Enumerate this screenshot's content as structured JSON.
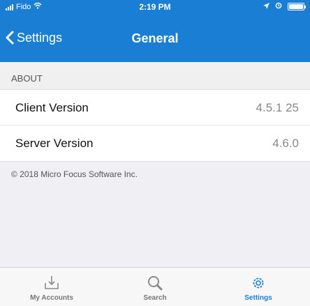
{
  "status_bar": {
    "carrier": "Fido",
    "time": "2:19 PM"
  },
  "nav": {
    "back_label": "Settings",
    "title": "General"
  },
  "about": {
    "header": "ABOUT",
    "rows": [
      {
        "label": "Client Version",
        "value": "4.5.1 25"
      },
      {
        "label": "Server Version",
        "value": "4.6.0"
      }
    ],
    "copyright": "© 2018 Micro Focus Software Inc."
  },
  "tabs": [
    {
      "label": "My Accounts",
      "icon": "download-tray-icon",
      "active": false
    },
    {
      "label": "Search",
      "icon": "magnifier-icon",
      "active": false
    },
    {
      "label": "Settings",
      "icon": "gear-icon",
      "active": true
    }
  ],
  "colors": {
    "accent": "#1a7fd4",
    "background": "#efeff4"
  }
}
